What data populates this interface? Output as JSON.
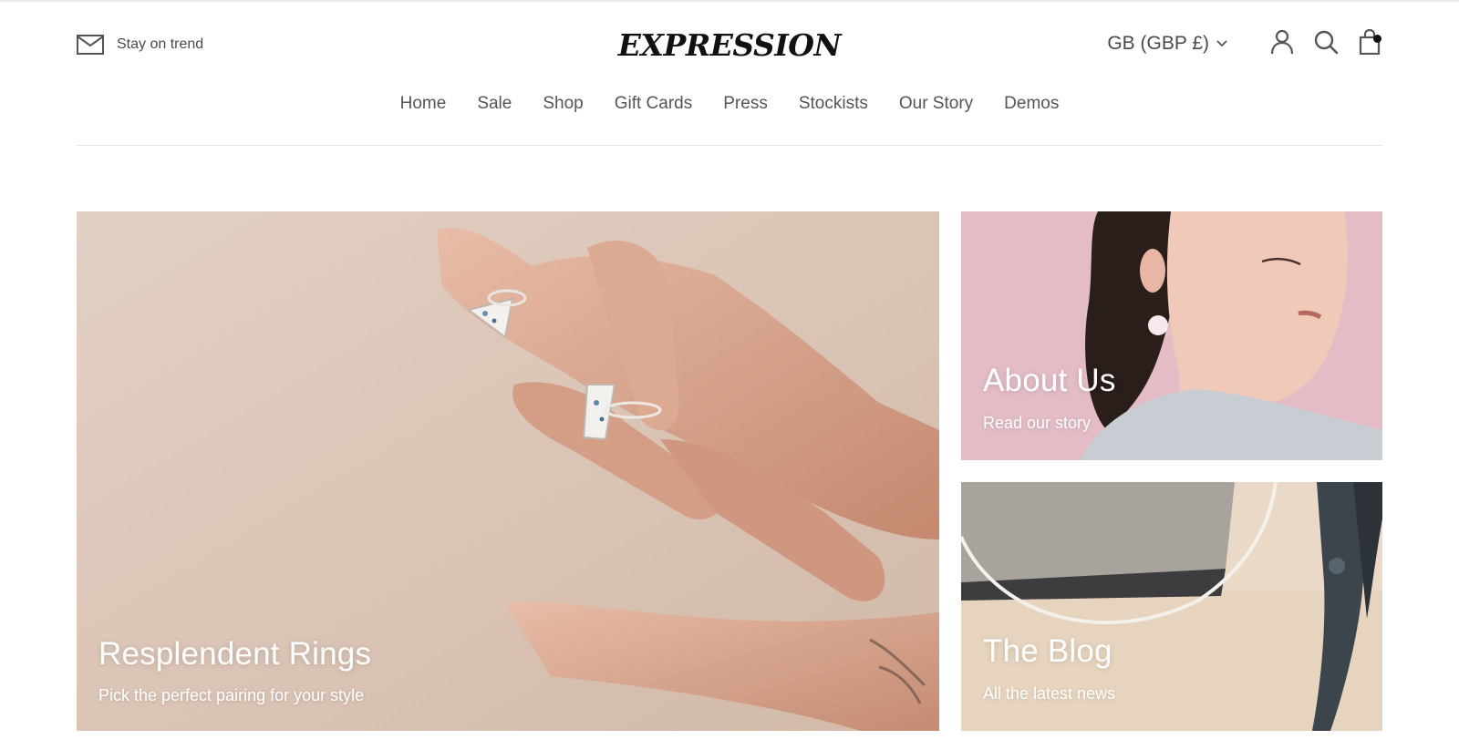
{
  "header": {
    "promo_text": "Stay on trend",
    "logo": "EXPRESSION",
    "currency": "GB (GBP £)",
    "nav": [
      "Home",
      "Sale",
      "Shop",
      "Gift Cards",
      "Press",
      "Stockists",
      "Our Story",
      "Demos"
    ],
    "icons": {
      "promo": "mail-icon",
      "currency": "chevron-down-icon",
      "account": "user-icon",
      "search": "search-icon",
      "cart": "shopping-bag-icon"
    },
    "cart_has_items": true
  },
  "tiles": {
    "main": {
      "title": "Resplendent Rings",
      "subtitle": "Pick the perfect pairing for your style"
    },
    "about": {
      "title": "About Us",
      "subtitle": "Read our story"
    },
    "blog": {
      "title": "The Blog",
      "subtitle": "All the latest news"
    }
  },
  "colors": {
    "text": "#2b2b2b",
    "muted": "#555555",
    "tile_main_bg": "#dcc7b9",
    "tile_about_bg": "#e6c1c8",
    "tile_blog_bg": "#e9dbcc"
  }
}
